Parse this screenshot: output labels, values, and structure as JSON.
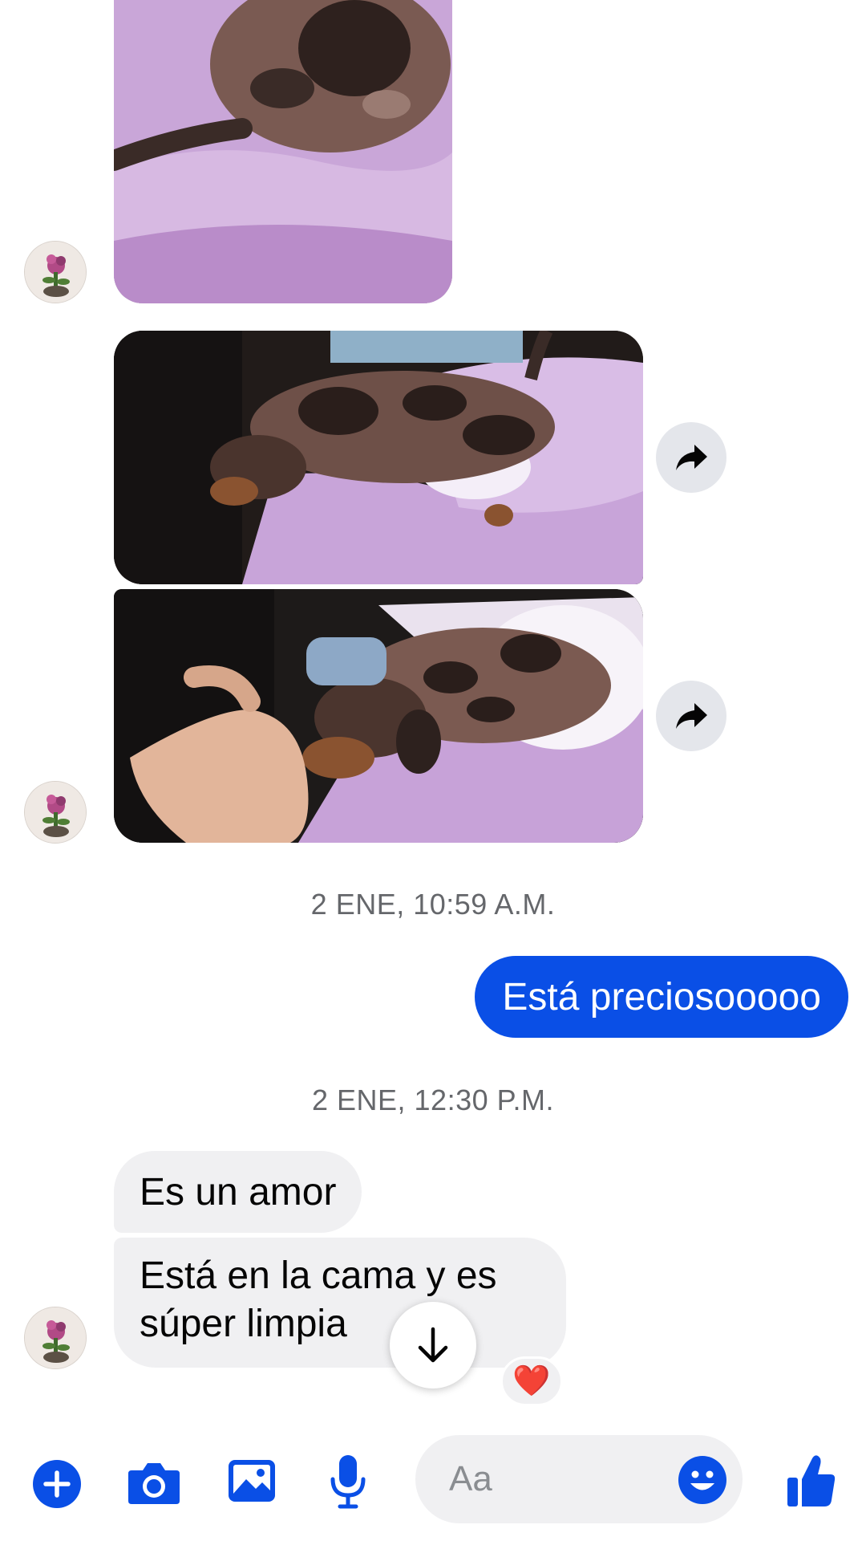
{
  "colors": {
    "accent": "#0a4fe6",
    "incoming_bubble": "#f0f0f2",
    "timestamp_text": "#65676b",
    "reaction_heart": "#e8182b"
  },
  "messages": {
    "timestamp_1": "2 ENE, 10:59 A.M.",
    "outgoing_1": "Está preciosooooo",
    "timestamp_2": "2 ENE, 12:30 P.M.",
    "incoming_1": "Es un amor",
    "incoming_2": "Está en la cama y es súper limpia",
    "reaction": "❤️"
  },
  "composer": {
    "placeholder": "Aa",
    "icons": [
      "plus-icon",
      "camera-icon",
      "gallery-icon",
      "microphone-icon",
      "emoji-icon",
      "thumbs-up-icon"
    ]
  },
  "share_icons": [
    "share-arrow-icon",
    "share-arrow-icon"
  ],
  "scroll_icon": "arrow-down-icon"
}
